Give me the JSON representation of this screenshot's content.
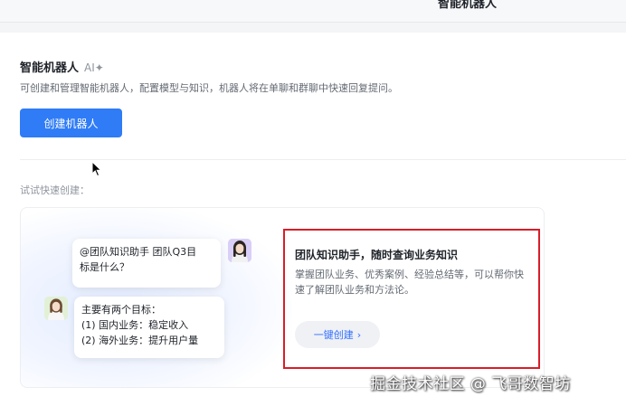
{
  "topbar": {
    "title": "智能机器人"
  },
  "section": {
    "title": "智能机器人",
    "ai_tag": "AI✦",
    "description": "可创建和管理智能机器人，配置模型与知识，机器人将在单聊和群聊中快速回复提问。",
    "create_button": "创建机器人"
  },
  "quick_create": {
    "hint": "试试快速创建：",
    "card": {
      "question_lines": [
        "@团队知识助手 团队Q3目",
        "标是什么？"
      ],
      "answer_lines": [
        "主要有两个目标：",
        "(1) 国内业务：稳定收入",
        "(2) 海外业务：提升用户量"
      ],
      "title": "团队知识助手，随时查询业务知识",
      "description": "掌握团队业务、优秀案例、经验总结等，可以帮你快速了解团队业务和方法论。",
      "button": "一键创建",
      "button_icon": "chevron-right-icon"
    }
  },
  "watermark": "掘金技术社区 @ 飞哥数智坊",
  "colors": {
    "primary": "#2f7cf6",
    "link": "#3370ff",
    "highlight_border": "#d81e2a",
    "panel_bg": "#ffffff",
    "page_bg": "#f4f5f7"
  }
}
